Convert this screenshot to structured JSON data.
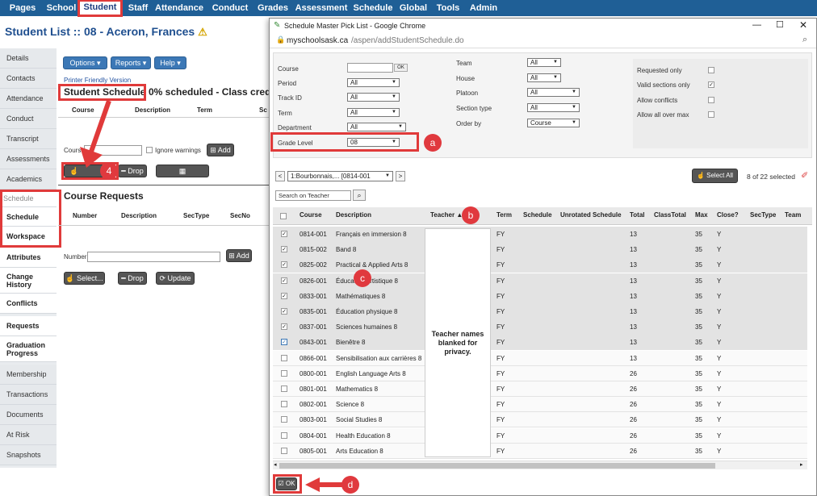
{
  "nav": {
    "items": [
      "Pages",
      "School",
      "Student",
      "Staff",
      "Attendance",
      "Conduct",
      "Grades",
      "Assessment",
      "Schedule",
      "Global",
      "Tools",
      "Admin"
    ],
    "active": "Student"
  },
  "page_title": "Student List :: 08 - Aceron, Frances",
  "sidebar": {
    "items": [
      "Details",
      "Contacts",
      "Attendance",
      "Conduct",
      "Transcript",
      "Assessments",
      "Academics",
      "Schedule",
      "Schedule",
      "Workspace",
      "Attributes",
      "Change History",
      "Conflicts",
      "Requests",
      "Graduation Progress",
      "Membership",
      "Transactions",
      "Documents",
      "At Risk",
      "Snapshots"
    ]
  },
  "toolbar": {
    "options": "Options",
    "reports": "Reports",
    "help": "Help"
  },
  "printer_link": "Printer Friendly Version",
  "schedule": {
    "heading": "Student Schedule",
    "summary": "0% scheduled - Class credits",
    "cols": [
      "Course",
      "Description",
      "Term",
      "Sc"
    ],
    "course_label": "Course",
    "ignore_warnings": "Ignore warnings",
    "add": "Add",
    "select": "Select...",
    "drop": "Drop",
    "reschedule": "Reschedule..."
  },
  "requests": {
    "heading": "Course Requests",
    "cols": [
      "Number",
      "Description",
      "SecType",
      "SecNo"
    ],
    "number_label": "Number",
    "add": "Add",
    "select": "Select...",
    "drop": "Drop",
    "update": "Update"
  },
  "popup": {
    "window_title": "Schedule Master Pick List - Google Chrome",
    "url_host": "myschoolsask.ca",
    "url_path": "/aspen/addStudentSchedule.do",
    "filters": {
      "course_label": "Course",
      "ok": "OK",
      "period_label": "Period",
      "period": "All",
      "trackid_label": "Track ID",
      "trackid": "All",
      "term_label": "Term",
      "term": "All",
      "department_label": "Department",
      "department": "All",
      "grade_label": "Grade Level",
      "grade": "08",
      "team_label": "Team",
      "team": "All",
      "house_label": "House",
      "house": "All",
      "platoon_label": "Platoon",
      "platoon": "All",
      "sectype_label": "Section type",
      "sectype": "All",
      "orderby_label": "Order by",
      "orderby": "Course",
      "requested_only": "Requested only",
      "valid_sections_only": "Valid sections only",
      "allow_conflicts": "Allow conflicts",
      "allow_all_over_max": "Allow all over max"
    },
    "teacher_select": "1:Bourbonnais,... [0814-001",
    "select_all": "Select All",
    "selected_count": "8 of 22 selected",
    "search_placeholder": "Search on Teacher",
    "columns": [
      "Course",
      "Description",
      "Teacher ▲",
      "Term",
      "Schedule",
      "Unrotated Schedule",
      "Total",
      "ClassTotal",
      "Max",
      "Close?",
      "SecType",
      "Team"
    ],
    "rows": [
      {
        "course": "0814-001",
        "desc": "Français en immersion 8",
        "term": "FY",
        "total": "13",
        "max": "35",
        "close": "Y",
        "checked": true
      },
      {
        "course": "0815-002",
        "desc": "Band 8",
        "term": "FY",
        "total": "13",
        "max": "35",
        "close": "Y",
        "checked": true
      },
      {
        "course": "0825-002",
        "desc": "Practical & Applied Arts 8",
        "term": "FY",
        "total": "13",
        "max": "35",
        "close": "Y",
        "checked": true
      },
      {
        "course": "0826-001",
        "desc": "Éducation artistique 8",
        "term": "FY",
        "total": "13",
        "max": "35",
        "close": "Y",
        "checked": true
      },
      {
        "course": "0833-001",
        "desc": "Mathématiques 8",
        "term": "FY",
        "total": "13",
        "max": "35",
        "close": "Y",
        "checked": true
      },
      {
        "course": "0835-001",
        "desc": "Éducation physique 8",
        "term": "FY",
        "total": "13",
        "max": "35",
        "close": "Y",
        "checked": true
      },
      {
        "course": "0837-001",
        "desc": "Sciences humaines 8",
        "term": "FY",
        "total": "13",
        "max": "35",
        "close": "Y",
        "checked": true
      },
      {
        "course": "0843-001",
        "desc": "Bienêtre 8",
        "term": "FY",
        "total": "13",
        "max": "35",
        "close": "Y",
        "checked": true
      },
      {
        "course": "0866-001",
        "desc": "Sensibilisation aux carrières 8",
        "term": "FY",
        "total": "13",
        "max": "35",
        "close": "Y",
        "checked": false
      },
      {
        "course": "0800-001",
        "desc": "English Language Arts 8",
        "term": "FY",
        "total": "26",
        "max": "35",
        "close": "Y",
        "checked": false
      },
      {
        "course": "0801-001",
        "desc": "Mathematics 8",
        "term": "FY",
        "total": "26",
        "max": "35",
        "close": "Y",
        "checked": false
      },
      {
        "course": "0802-001",
        "desc": "Science 8",
        "term": "FY",
        "total": "26",
        "max": "35",
        "close": "Y",
        "checked": false
      },
      {
        "course": "0803-001",
        "desc": "Social Studies 8",
        "term": "FY",
        "total": "26",
        "max": "35",
        "close": "Y",
        "checked": false
      },
      {
        "course": "0804-001",
        "desc": "Health Education 8",
        "term": "FY",
        "total": "26",
        "max": "35",
        "close": "Y",
        "checked": false
      },
      {
        "course": "0805-001",
        "desc": "Arts Education 8",
        "term": "FY",
        "total": "26",
        "max": "35",
        "close": "Y",
        "checked": false
      }
    ],
    "privacy_note": "Teacher names blanked for privacy.",
    "ok_button": "OK"
  },
  "callouts": {
    "four": "4",
    "a": "a",
    "b": "b",
    "c": "c",
    "d": "d"
  },
  "colors": {
    "nav": "#1f5f96",
    "accent": "#3c78b6",
    "callout": "#e0393e"
  }
}
